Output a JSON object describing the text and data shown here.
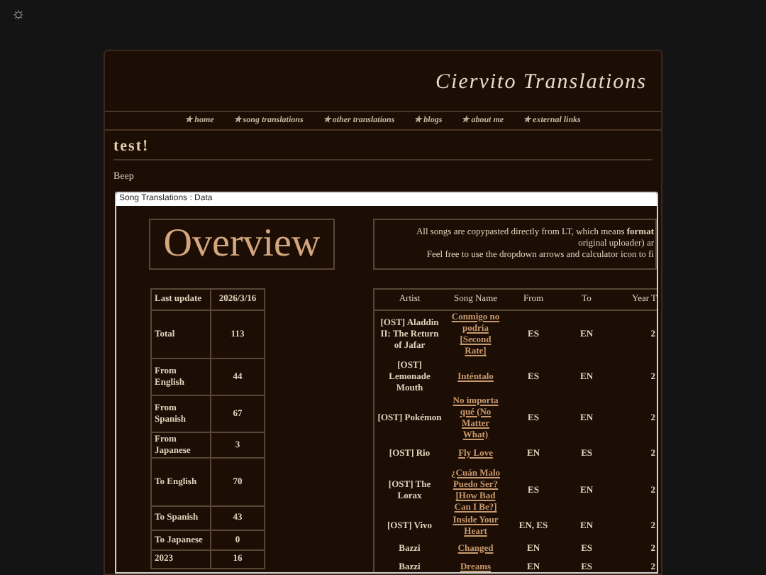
{
  "corner_icon": "☼",
  "site_title": "Ciervito Translations",
  "nav": [
    {
      "label": "✮ home"
    },
    {
      "label": "✮ song translations"
    },
    {
      "label": "✮ other translations"
    },
    {
      "label": "✮ blogs"
    },
    {
      "label": "✮ about me"
    },
    {
      "label": "✮ external links"
    }
  ],
  "post": {
    "title": "test!",
    "body": "Beep"
  },
  "sheet": {
    "title": "Song Translations : Data",
    "heading": "Overview",
    "notice_lines": [
      "All songs are copypasted directly from LT, which means **format**",
      "original uploader) ar",
      "Feel free to use the dropdown arrows and calculator icon to fi"
    ],
    "overview_rows": [
      {
        "label": "Last update",
        "value": "2026/3/16"
      },
      {
        "label": "Total",
        "value": "113"
      },
      {
        "label": "From English",
        "value": "44"
      },
      {
        "label": "From Spanish",
        "value": "67"
      },
      {
        "label": "From Japanese",
        "value": "3"
      },
      {
        "label": "To English",
        "value": "70"
      },
      {
        "label": "To Spanish",
        "value": "43"
      },
      {
        "label": "To Japanese",
        "value": "0"
      },
      {
        "label": "2023",
        "value": "16"
      }
    ],
    "songs_columns": [
      "Artist",
      "Song Name",
      "From",
      "To",
      "Year T"
    ],
    "songs_rows": [
      {
        "artist": "[OST] Aladdin II: The Return of Jafar",
        "song": "Conmigo no podría [Second Rate]",
        "from": "ES",
        "to": "EN",
        "column_5": "2"
      },
      {
        "artist": "[OST] Lemonade Mouth",
        "song": "Inténtalo",
        "from": "ES",
        "to": "EN",
        "column_5": "2"
      },
      {
        "artist": "[OST] Pokémon",
        "song": "No importa qué (No Matter What)",
        "from": "ES",
        "to": "EN",
        "column_5": "2"
      },
      {
        "artist": "[OST] Rio",
        "song": "Fly Love",
        "from": "EN",
        "to": "ES",
        "column_5": "2"
      },
      {
        "artist": "[OST] The Lorax",
        "song": "¿Cuán Malo Puedo Ser? [How Bad Can I Be?]",
        "from": "ES",
        "to": "EN",
        "column_5": "2"
      },
      {
        "artist": "[OST] Vivo",
        "song": "Inside Your Heart",
        "from": "EN, ES",
        "to": "EN",
        "column_5": "2"
      },
      {
        "artist": "Bazzi",
        "song": "Changed",
        "from": "EN",
        "to": "ES",
        "column_5": "2"
      },
      {
        "artist": "Bazzi",
        "song": "Dreams",
        "from": "EN",
        "to": "ES",
        "column_5": "2"
      }
    ]
  }
}
